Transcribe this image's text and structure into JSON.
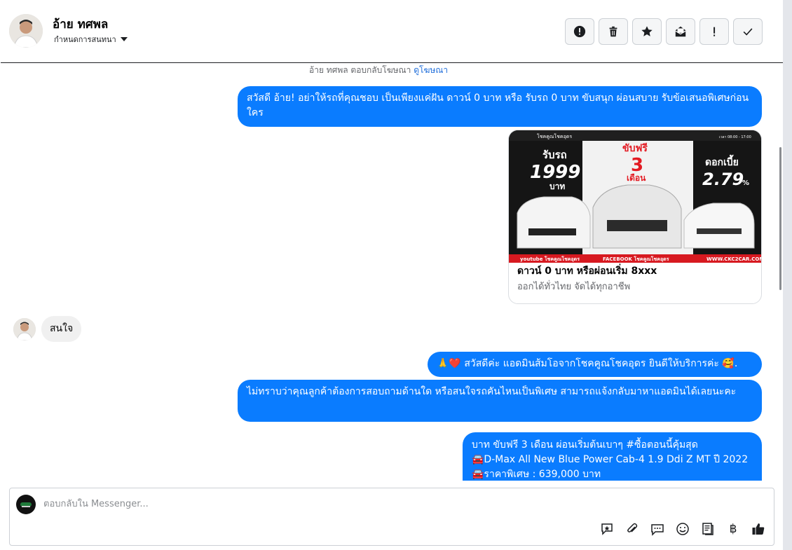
{
  "header": {
    "contact_name": "อ้าย ทศพล",
    "assign_label": "กำหนดการสนทนา",
    "actions": [
      {
        "name": "report-spam-button",
        "icon": "alert-circle-icon"
      },
      {
        "name": "delete-button",
        "icon": "trash-icon"
      },
      {
        "name": "star-button",
        "icon": "star-icon"
      },
      {
        "name": "mark-unread-button",
        "icon": "envelope-open-icon"
      },
      {
        "name": "follow-up-button",
        "icon": "exclamation-icon"
      },
      {
        "name": "mark-done-button",
        "icon": "check-icon"
      }
    ]
  },
  "thread": {
    "ad_note_text": "อ้าย ทศพล ตอบกลับโฆษณา",
    "ad_note_link": "ดูโฆษณา",
    "msg_greeting": "สวัสดี อ้าย! อย่าให้รถที่คุณชอบ เป็นเพียงแค่ฝัน ดาวน์ 0 บาท หรือ รับรถ 0 บาท ขับสนุก ผ่อนสบาย รับข้อเสนอพิเศษก่อนใคร",
    "ad_card": {
      "title": "ดาวน์ 0 บาท หรือผ่อนเริ่ม 8xxx",
      "subtitle": "ออกได้ทั่วไทย จัดได้ทุกอาชีพ",
      "image": {
        "top_brand": "โชคคูณโชคอุดร",
        "hours": "เวลา 08:00 - 17:00",
        "promo_left_label": "รับรถ",
        "promo_left_value": "1999",
        "promo_left_unit": "บาท",
        "promo_mid_label": "ขับฟรี",
        "promo_mid_value": "3",
        "promo_mid_unit": "เดือน",
        "promo_right_label": "ดอกเบี้ย",
        "promo_right_value": "2.79",
        "promo_right_unit": "%",
        "footer_left": "youtube โชคคูณโชคอุดร",
        "footer_mid": "FACEBOOK โชคคูณโชคอุดร",
        "footer_right": "WWW.CKC2CAR.COM"
      }
    },
    "msg_incoming": "สนใจ",
    "msg_welcome": "🙏❤️ สวัสดีค่ะ แอดมินส้มโอจากโชคคูณโชคอุดร ยินดีให้บริการค่ะ 🥰.",
    "msg_question": "ไม่ทราบว่าคุณลูกค้าต้องการสอบถามด้านใด หรือสนใจรถคันไหนเป็นพิเศษ สามารถแจ้งกลับมาหาแอดมินได้เลยนะคะ",
    "msg_promo_line1": "บาท ขับฟรี 3 เดือน ผ่อนเริ่มต้นเบาๆ  #ซื้อตอนนี้คุ้มสุด",
    "msg_promo_line2": "🚘D-Max All New Blue Power Cab-4 1.9 Ddi Z MT ปี 2022",
    "msg_promo_line3": "🚘ราคาพิเศษ : 639,000 บาท"
  },
  "composer": {
    "placeholder": "ตอบกลับใน Messenger...",
    "tools": [
      "saved-reply-icon",
      "attachment-icon",
      "chat-bubble-icon",
      "emoji-icon",
      "catalog-icon",
      "baht-payment-icon",
      "like-icon"
    ],
    "baht_symbol": "฿"
  },
  "colors": {
    "outgoing_bubble": "#0a7cff",
    "incoming_bubble": "#f0f0f0",
    "link": "#216fdb",
    "muted_text": "#65676b"
  }
}
